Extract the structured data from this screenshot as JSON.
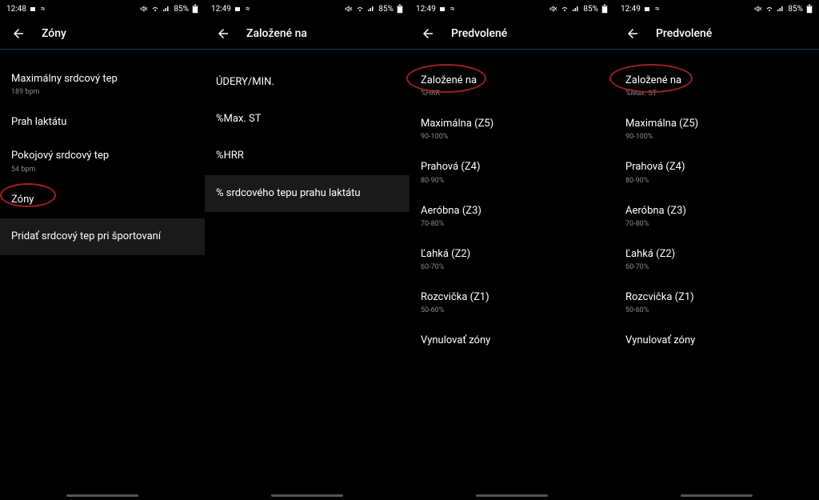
{
  "panels": [
    {
      "status": {
        "time": "12:48",
        "battery": "85%"
      },
      "header": {
        "title": "Zóny"
      },
      "items": [
        {
          "title": "Maximálny srdcový tep",
          "sub": "189 bpm"
        },
        {
          "title": "Prah laktátu",
          "sub": ""
        },
        {
          "title": "Pokojový srdcový tep",
          "sub": "54 bpm"
        },
        {
          "title": "Zóny",
          "sub": "",
          "circled": true
        },
        {
          "title": "Pridať srdcový tep pri športovaní",
          "sub": "",
          "highlighted": true
        }
      ]
    },
    {
      "status": {
        "time": "12:49",
        "battery": "85%"
      },
      "header": {
        "title": "Založené na"
      },
      "items": [
        {
          "title": "ÚDERY/MIN.",
          "sub": ""
        },
        {
          "title": "%Max. ST",
          "sub": ""
        },
        {
          "title": "%HRR",
          "sub": ""
        },
        {
          "title": "% srdcového tepu prahu laktátu",
          "sub": "",
          "highlighted": true
        }
      ]
    },
    {
      "status": {
        "time": "12:49",
        "battery": "85%"
      },
      "header": {
        "title": "Predvolené"
      },
      "items": [
        {
          "title": "Založené na",
          "sub": "%HRR",
          "circled": true
        },
        {
          "title": "Maximálna (Z5)",
          "sub": "90-100%"
        },
        {
          "title": "Prahová (Z4)",
          "sub": "80-90%"
        },
        {
          "title": "Aeróbna (Z3)",
          "sub": "70-80%"
        },
        {
          "title": "Ľahká (Z2)",
          "sub": "60-70%"
        },
        {
          "title": "Rozcvička (Z1)",
          "sub": "50-60%"
        },
        {
          "title": "Vynulovať zóny",
          "sub": ""
        }
      ]
    },
    {
      "status": {
        "time": "12:49",
        "battery": "85%"
      },
      "header": {
        "title": "Predvolené"
      },
      "items": [
        {
          "title": "Založené na",
          "sub": "%Max. ST",
          "circled": true
        },
        {
          "title": "Maximálna (Z5)",
          "sub": "90-100%"
        },
        {
          "title": "Prahová (Z4)",
          "sub": "80-90%"
        },
        {
          "title": "Aeróbna (Z3)",
          "sub": "70-80%"
        },
        {
          "title": "Ľahká (Z2)",
          "sub": "60-70%"
        },
        {
          "title": "Rozcvička (Z1)",
          "sub": "50-60%"
        },
        {
          "title": "Vynulovať zóny",
          "sub": ""
        }
      ]
    }
  ]
}
